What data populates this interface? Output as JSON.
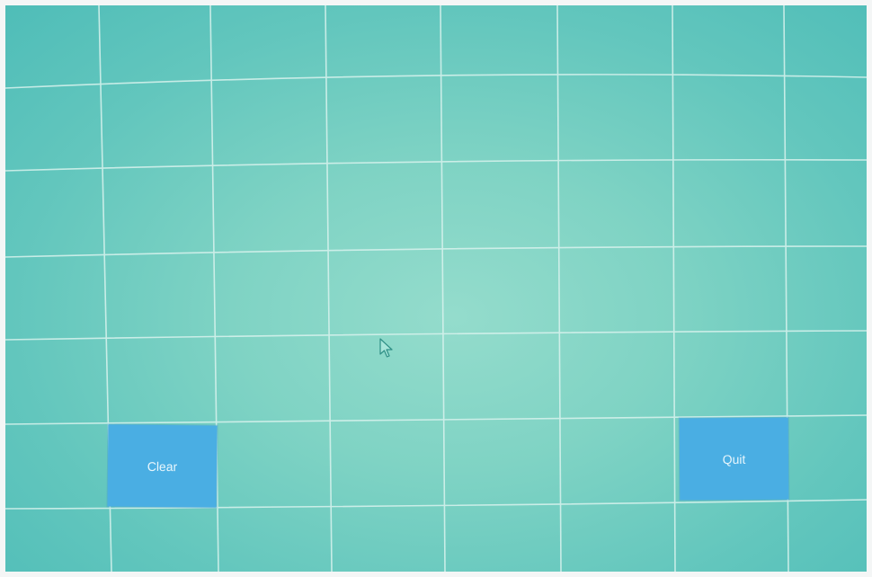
{
  "screen": {
    "background_color": "#7fd3c4",
    "grid_line_color": "#d9f3ee"
  },
  "buttons": {
    "clear_label": "Clear",
    "quit_label": "Quit",
    "button_color": "#4aaee3"
  },
  "cursor": {
    "icon": "arrow-pointer-icon"
  }
}
